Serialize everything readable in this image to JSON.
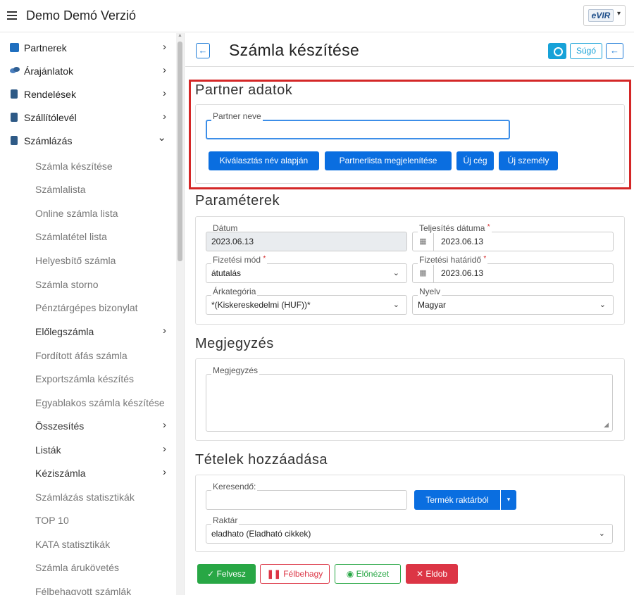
{
  "app": {
    "title": "Demo Demó Verzió",
    "logo_text": "eVIR"
  },
  "sidebar": {
    "items": [
      {
        "label": "Partnerek",
        "level": 1,
        "chevron": "›"
      },
      {
        "label": "Árajánlatok",
        "level": 1,
        "chevron": "›"
      },
      {
        "label": "Rendelések",
        "level": 1,
        "chevron": "›"
      },
      {
        "label": "Szállítólevél",
        "level": 1,
        "chevron": "›"
      },
      {
        "label": "Számlázás",
        "level": 1,
        "chevron": "⌄"
      },
      {
        "label": "Számla készítése",
        "level": 2
      },
      {
        "label": "Számlalista",
        "level": 2
      },
      {
        "label": "Online számla lista",
        "level": 2
      },
      {
        "label": "Számlatétel lista",
        "level": 2
      },
      {
        "label": "Helyesbítő számla",
        "level": 2
      },
      {
        "label": "Számla storno",
        "level": 2
      },
      {
        "label": "Pénztárgépes bizonylat",
        "level": 2
      },
      {
        "label": "Előlegszámla",
        "level": 2,
        "chevron": "›"
      },
      {
        "label": "Fordított áfás számla",
        "level": 2
      },
      {
        "label": "Exportszámla készítés",
        "level": 2
      },
      {
        "label": "Egyablakos számla készítése",
        "level": 2
      },
      {
        "label": "Összesítés",
        "level": 2,
        "chevron": "›"
      },
      {
        "label": "Listák",
        "level": 2,
        "chevron": "›"
      },
      {
        "label": "Kéziszámla",
        "level": 2,
        "chevron": "›"
      },
      {
        "label": "Számlázás statisztikák",
        "level": 2
      },
      {
        "label": "TOP 10",
        "level": 2
      },
      {
        "label": "KATA statisztikák",
        "level": 2
      },
      {
        "label": "Számla árukövetés",
        "level": 2
      },
      {
        "label": "Félbehagyott számlák",
        "level": 2
      }
    ]
  },
  "header": {
    "title": "Számla készítése",
    "help_label": "Súgó",
    "back_icon": "←"
  },
  "partner": {
    "section_title": "Partner adatok",
    "name_label": "Partner neve",
    "name_value": "",
    "buttons": [
      "Kiválasztás név alapján",
      "Partnerlista megjelenítése",
      "Új cég",
      "Új személy"
    ]
  },
  "params": {
    "section_title": "Paraméterek",
    "date_label": "Dátum",
    "date_value": "2023.06.13",
    "fulfillment_label": "Teljesítés dátuma",
    "fulfillment_value": "2023.06.13",
    "payment_label": "Fizetési mód",
    "payment_value": "átutalás",
    "deadline_label": "Fizetési határidő",
    "deadline_value": "2023.06.13",
    "price_cat_label": "Árkategória",
    "price_cat_value": "*(Kiskereskedelmi (HUF))*",
    "language_label": "Nyelv",
    "language_value": "Magyar",
    "required_mark": "*"
  },
  "note": {
    "section_title": "Megjegyzés",
    "field_label": "Megjegyzés",
    "value": ""
  },
  "items": {
    "section_title": "Tételek hozzáadása",
    "search_label": "Keresendő:",
    "search_value": "",
    "stock_button": "Termék raktárból",
    "warehouse_label": "Raktár",
    "warehouse_value": "eladhato (Eladható cikkek)"
  },
  "actions": {
    "save": "Felvesz",
    "pause": "Félbehagy",
    "preview": "Előnézet",
    "discard": "Eldob"
  },
  "colors": {
    "primary": "#0a6ee0",
    "success": "#28a745",
    "danger": "#dc3545",
    "info": "#17a2d8",
    "highlight": "#d42727"
  }
}
